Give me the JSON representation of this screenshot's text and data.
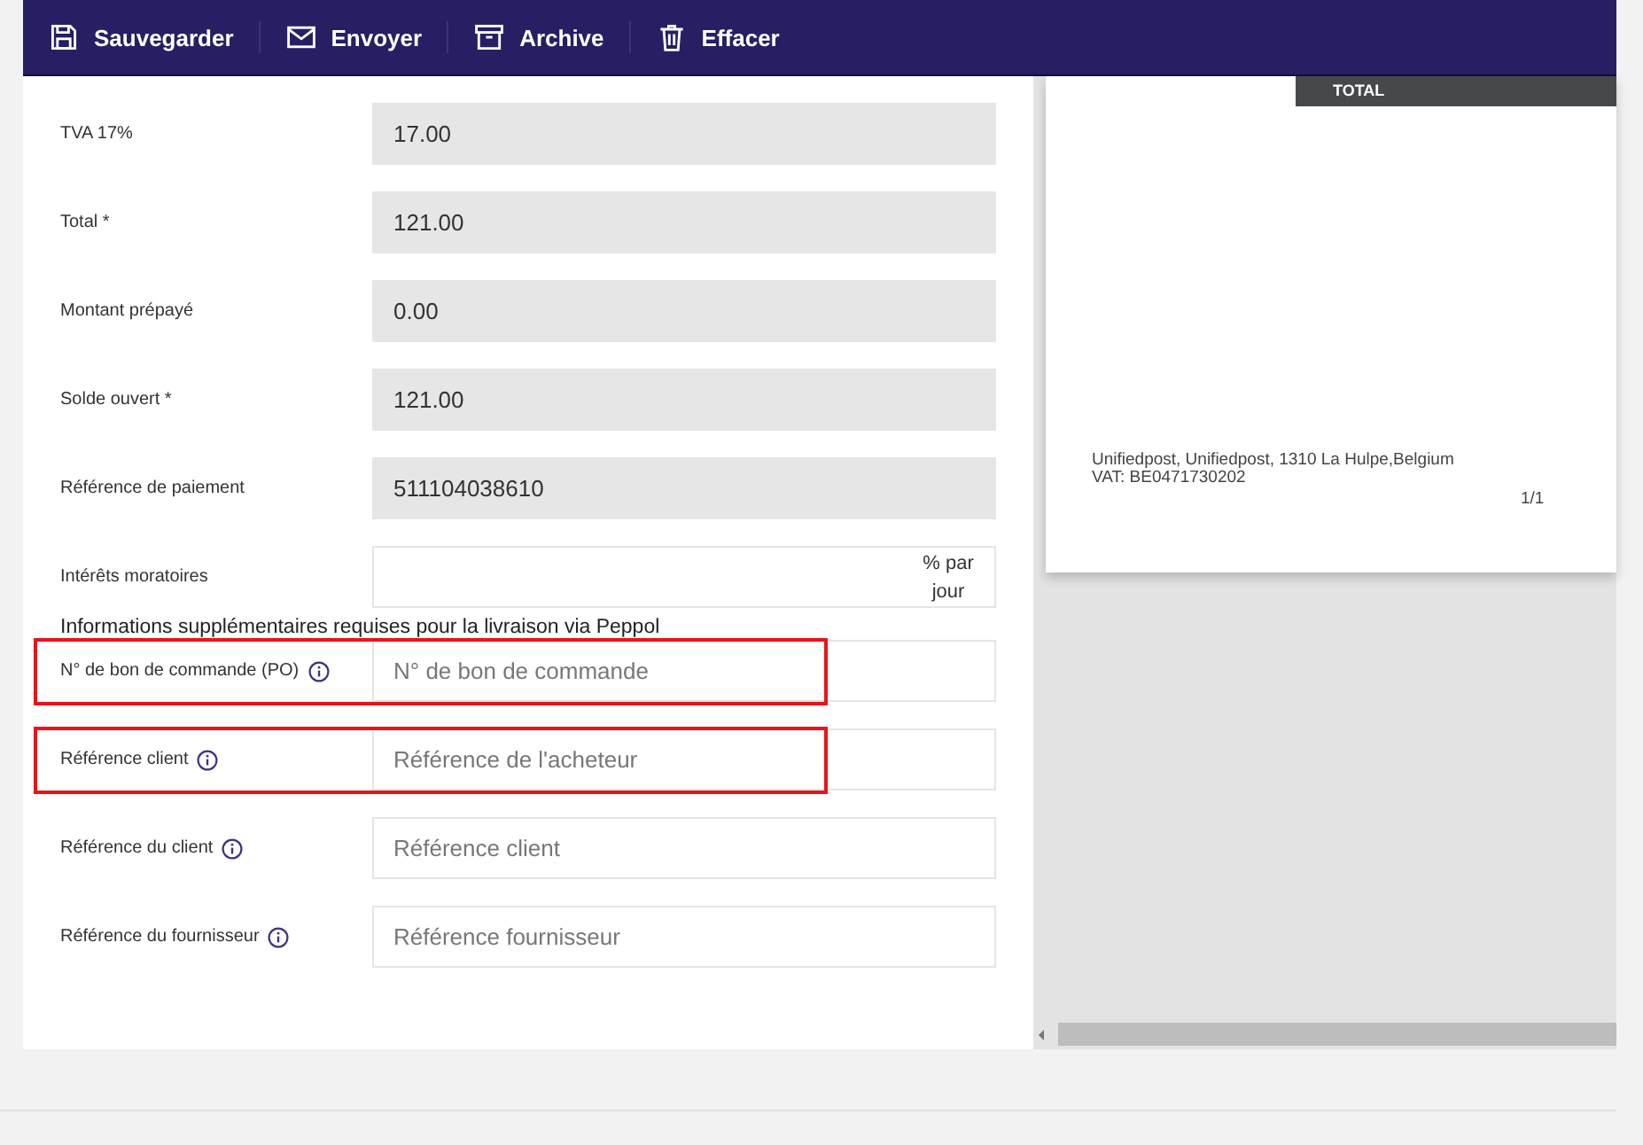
{
  "toolbar": {
    "buttons": [
      {
        "kind": "save",
        "label": "Sauvegarder"
      },
      {
        "kind": "send",
        "label": "Envoyer"
      },
      {
        "kind": "archive",
        "label": "Archive"
      },
      {
        "kind": "delete",
        "label": "Effacer"
      }
    ]
  },
  "form": {
    "rows": [
      {
        "kind": "readonly",
        "label": "TVA 17%",
        "value": "17.00"
      },
      {
        "kind": "readonly",
        "label": "Total *",
        "value": "121.00"
      },
      {
        "kind": "readonly",
        "label": "Montant prépayé",
        "value": "0.00"
      },
      {
        "kind": "readonly",
        "label": "Solde ouvert *",
        "value": "121.00"
      },
      {
        "kind": "readonly",
        "label": "Référence de paiement",
        "value": "511104038610"
      },
      {
        "kind": "suffix",
        "label": "Intérêts moratoires",
        "suffix": "% par jour"
      },
      {
        "kind": "heading",
        "label": "Informations supplémentaires requises pour la livraison via Peppol"
      },
      {
        "kind": "input",
        "label": "N° de bon de commande (PO)",
        "info": true,
        "placeholder": "N° de bon de commande",
        "highlighted": true
      },
      {
        "kind": "input",
        "label": "Référence client",
        "info": true,
        "placeholder": "Référence de l'acheteur",
        "highlighted": true
      },
      {
        "kind": "input",
        "label": "Référence du client",
        "info": true,
        "placeholder": "Référence client",
        "highlighted": false
      },
      {
        "kind": "input",
        "label": "Référence du fournisseur",
        "info": true,
        "placeholder": "Référence fournisseur",
        "highlighted": false
      }
    ]
  },
  "preview": {
    "total_header": "TOTAL",
    "footer_lines": [
      "Unifiedpost, Unifiedpost, 1310 La Hulpe,Belgium",
      "VAT: BE0471730202"
    ],
    "page_number": "1/1"
  }
}
